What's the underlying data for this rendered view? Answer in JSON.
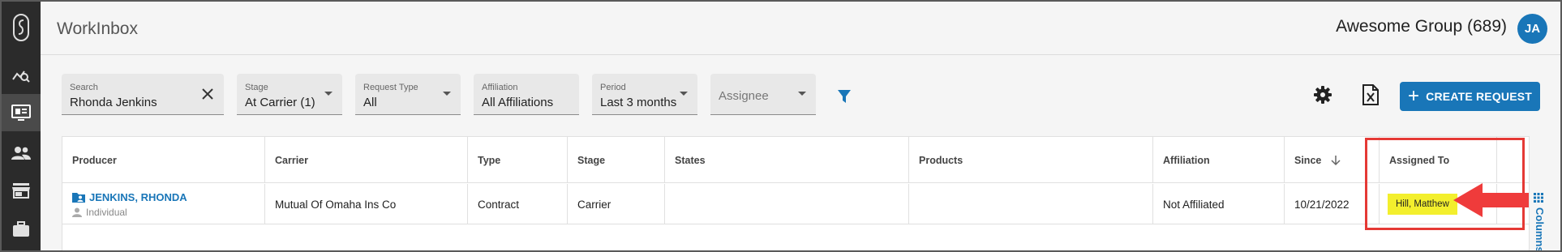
{
  "app": {
    "title": "WorkInbox",
    "group_name": "Awesome Group (689)",
    "user_initials": "JA"
  },
  "sidebar": {
    "items": [
      {
        "icon": "analytics-icon"
      },
      {
        "icon": "monitor-inbox-icon",
        "active": true
      },
      {
        "icon": "people-icon"
      },
      {
        "icon": "store-icon"
      },
      {
        "icon": "briefcase-icon"
      }
    ]
  },
  "filters": {
    "search": {
      "label": "Search",
      "value": "Rhonda Jenkins"
    },
    "stage": {
      "label": "Stage",
      "value": "At Carrier (1)"
    },
    "request_type": {
      "label": "Request Type",
      "value": "All"
    },
    "affiliation": {
      "label": "Affiliation",
      "value": "All Affiliations"
    },
    "period": {
      "label": "Period",
      "value": "Last 3 months"
    },
    "assignee": {
      "placeholder": "Assignee"
    }
  },
  "toolbar": {
    "create_label": "CREATE REQUEST"
  },
  "table": {
    "columns": [
      "Producer",
      "Carrier",
      "Type",
      "Stage",
      "States",
      "Products",
      "Affiliation",
      "Since",
      "Assigned To"
    ],
    "rows": [
      {
        "producer": "JENKINS, RHONDA",
        "producer_type": "Individual",
        "carrier": "Mutual Of Omaha Ins Co",
        "type": "Contract",
        "stage": "Carrier",
        "states": "",
        "products": "",
        "affiliation": "Not Affiliated",
        "since": "10/21/2022",
        "assigned_to": "Hill, Matthew"
      }
    ],
    "columns_panel_label": "Columns"
  },
  "colors": {
    "accent": "#1976b8",
    "highlight": "#f3ef2d",
    "annotation": "#e53935",
    "sidebar": "#2b2b2b"
  }
}
